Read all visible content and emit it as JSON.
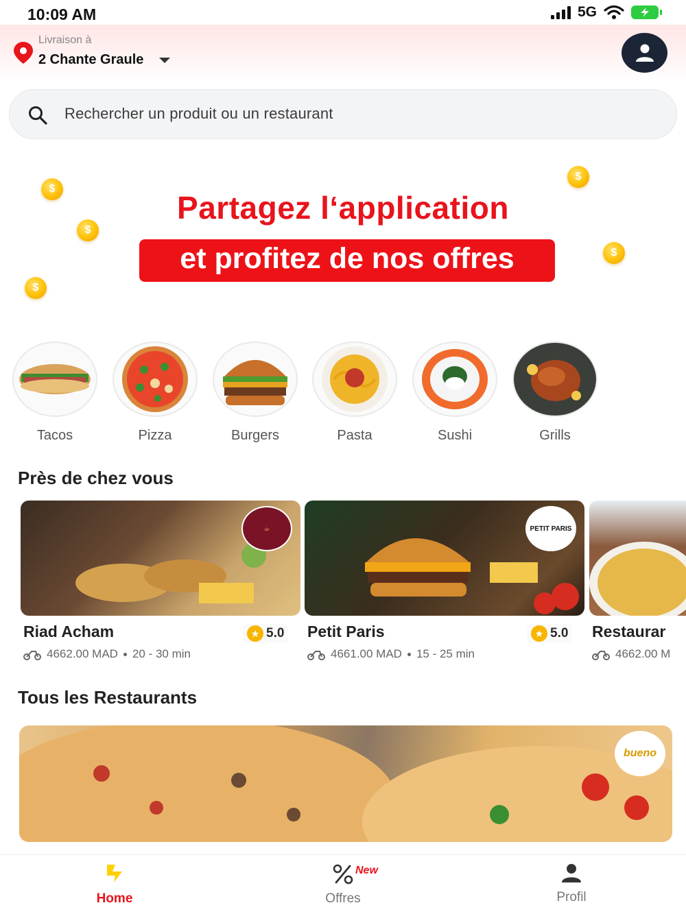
{
  "status_bar": {
    "time": "10:09 AM",
    "network": "5G",
    "icons": [
      "signal-icon",
      "wifi-icon",
      "battery-charging-icon"
    ]
  },
  "header": {
    "delivery_label": "Livraison à",
    "address": "2 Chante Graule",
    "icons": [
      "location-pin-icon",
      "chevron-down-icon",
      "user-avatar-icon"
    ]
  },
  "search": {
    "placeholder": "Rechercher un produit ou un restaurant",
    "icon": "search-icon"
  },
  "banner": {
    "line1": "Partagez l‘application",
    "line2": "et profitez de nos offres",
    "coin_symbol": "$"
  },
  "categories": [
    {
      "label": "Tacos"
    },
    {
      "label": "Pizza"
    },
    {
      "label": "Burgers"
    },
    {
      "label": "Pasta"
    },
    {
      "label": "Sushi"
    },
    {
      "label": "Grills"
    }
  ],
  "near_you": {
    "title": "Près de chez vous",
    "restaurants": [
      {
        "name": "Riad Acham",
        "rating": "5.0",
        "fee": "4662.00 MAD",
        "time": "20 - 30 min"
      },
      {
        "name": "Petit Paris",
        "rating": "5.0",
        "fee": "4661.00 MAD",
        "time": "15 - 25 min",
        "logo_text": "PETIT PARIS"
      },
      {
        "name": "Restaurar",
        "fee": "4662.00 M"
      }
    ]
  },
  "all_restaurants": {
    "title": "Tous les Restaurants",
    "featured_logo_text": "bueno"
  },
  "bottom_nav": {
    "home": "Home",
    "offers": "Offres",
    "offers_badge": "New",
    "profile": "Profil"
  },
  "colors": {
    "accent": "#e8141c",
    "home_icon": "#ffd000",
    "dark": "#1c2536",
    "star": "#f7b500"
  }
}
